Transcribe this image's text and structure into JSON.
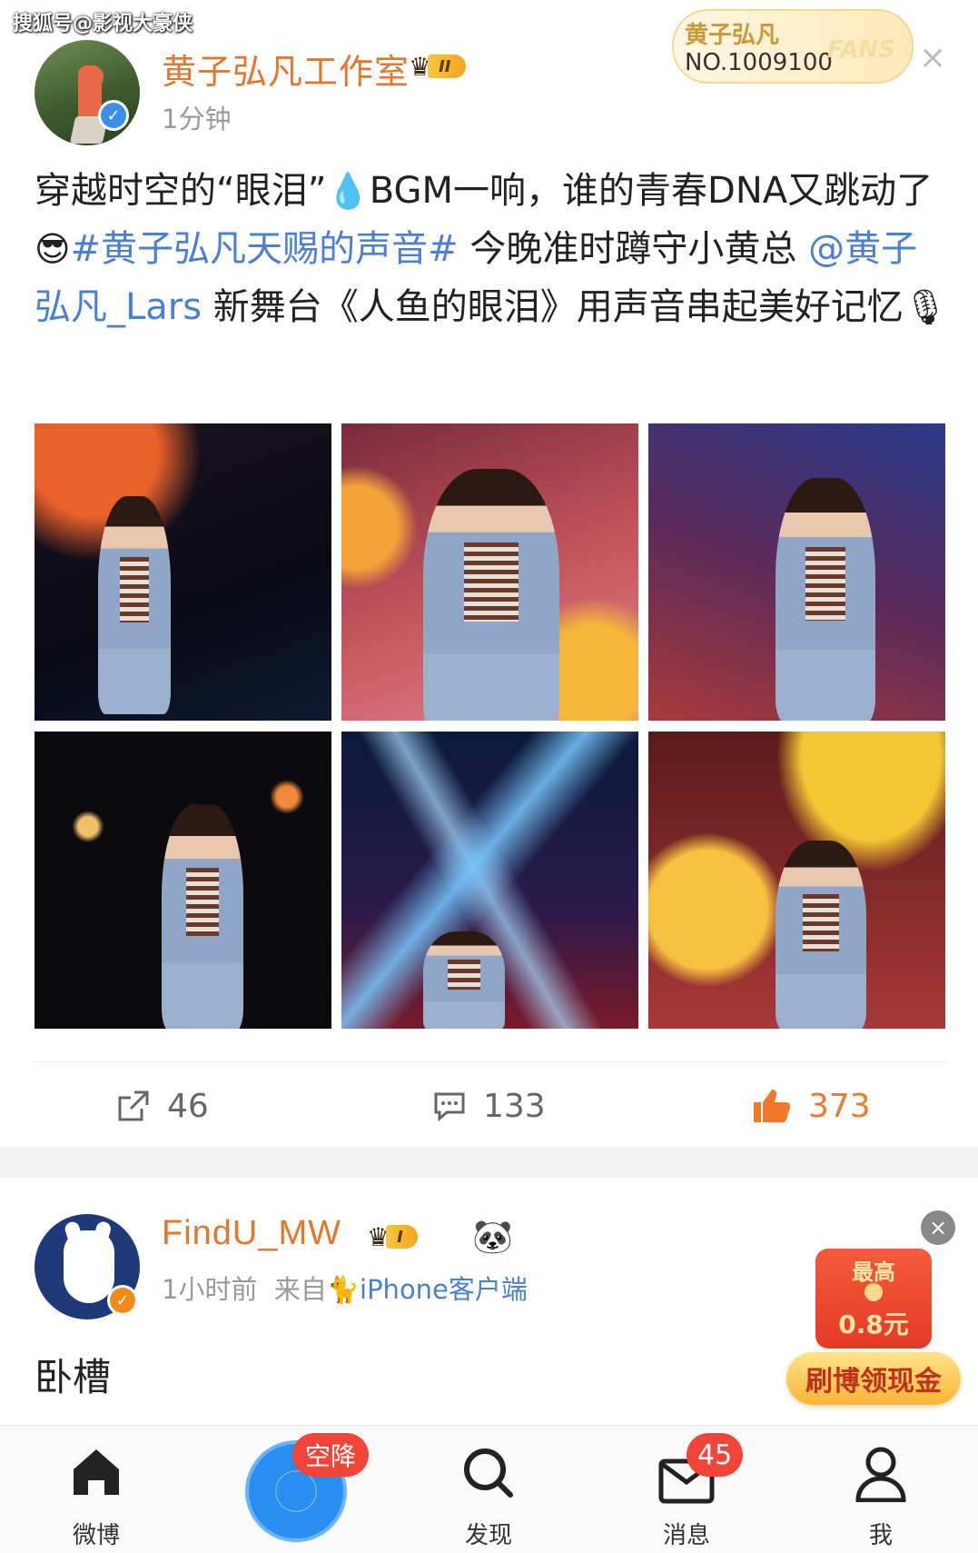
{
  "watermark": "搜狐号@影视大豪侠",
  "post1": {
    "username": "黄子弘凡工作室",
    "level_badge": "II",
    "time": "1分钟",
    "fans_badge": {
      "name": "黄子弘凡",
      "number": "NO.1009100",
      "word": "FANS"
    },
    "close": "×",
    "text_parts": {
      "a": "穿越时空的“眼泪”",
      "drop_emoji": "💧",
      "b": "BGM一响，谁的青春DNA又跳动了",
      "sunglasses_emoji": "😎",
      "hashtag": "#黄子弘凡天赐的声音#",
      "c": " 今晚准时蹲守小黄总 ",
      "mention": "@黄子弘凡_Lars",
      "d": " 新舞台《人鱼的眼泪》用声音串起美好记忆",
      "mic_emoji": "🎙"
    },
    "actions": {
      "repost": "46",
      "comment": "133",
      "like": "373"
    }
  },
  "post2": {
    "username": "FindU_MW",
    "level_badge": "I",
    "panda_emoji": "🐼",
    "time": "1小时前",
    "source_prefix": "来自",
    "source": "🐈iPhone客户端",
    "text": "卧槽",
    "red_packet": {
      "top": "最高",
      "amount": "0.8元",
      "button": "刷博领现金"
    },
    "close": "×"
  },
  "tabbar": {
    "home": "微博",
    "drop_badge": "空降",
    "discover": "发现",
    "messages": "消息",
    "messages_badge": "45",
    "me": "我"
  },
  "colors": {
    "accent_orange": "#e5762a",
    "link_blue": "#4a7fd6",
    "like_orange": "#f07a2a",
    "badge_red": "#f2453a"
  }
}
